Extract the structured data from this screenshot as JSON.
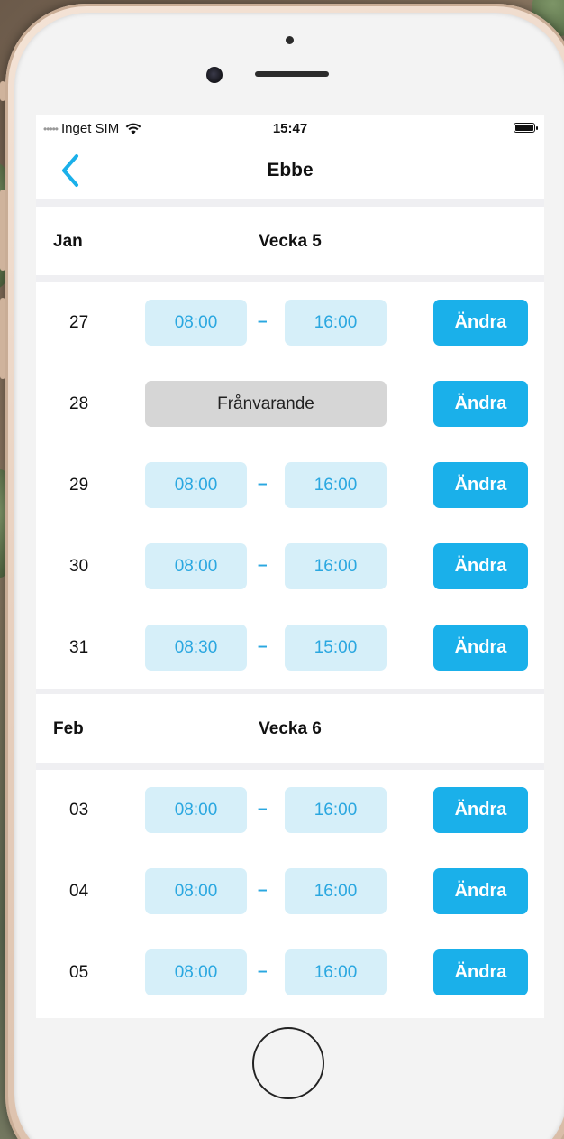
{
  "status_bar": {
    "carrier": "Inget SIM",
    "time": "15:47"
  },
  "nav": {
    "title": "Ebbe"
  },
  "weeks": [
    {
      "month": "Jan",
      "week_label": "Vecka 5",
      "days": [
        {
          "day": "27",
          "start": "08:00",
          "end": "16:00",
          "action": "Ändra"
        },
        {
          "day": "28",
          "status": "Frånvarande",
          "action": "Ändra"
        },
        {
          "day": "29",
          "start": "08:00",
          "end": "16:00",
          "action": "Ändra"
        },
        {
          "day": "30",
          "start": "08:00",
          "end": "16:00",
          "action": "Ändra"
        },
        {
          "day": "31",
          "start": "08:30",
          "end": "15:00",
          "action": "Ändra"
        }
      ]
    },
    {
      "month": "Feb",
      "week_label": "Vecka 6",
      "days": [
        {
          "day": "03",
          "start": "08:00",
          "end": "16:00",
          "action": "Ändra"
        },
        {
          "day": "04",
          "start": "08:00",
          "end": "16:00",
          "action": "Ändra"
        },
        {
          "day": "05",
          "start": "08:00",
          "end": "16:00",
          "action": "Ändra"
        }
      ]
    }
  ],
  "separator": "–",
  "colors": {
    "accent": "#1ab0ea",
    "time_bg": "#d6eff9",
    "time_text": "#2aa7e0",
    "absent_bg": "#d6d6d6",
    "screen_bg": "#efeff2"
  },
  "icons": {
    "back": "chevron-left-icon",
    "wifi": "wifi-icon",
    "battery": "battery-icon"
  }
}
